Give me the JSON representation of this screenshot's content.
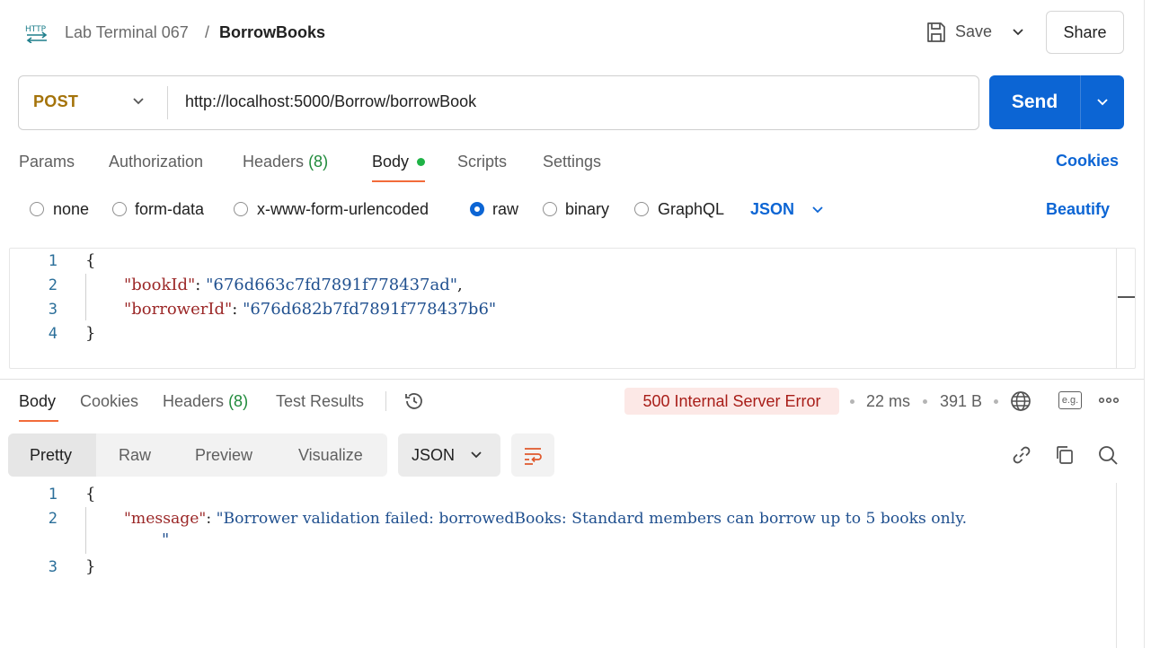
{
  "header": {
    "http_icon_label": "HTTP",
    "breadcrumb_parent": "Lab Terminal 067",
    "breadcrumb_separator": "/",
    "breadcrumb_current": "BorrowBooks",
    "save_label": "Save",
    "share_label": "Share"
  },
  "request": {
    "method": "POST",
    "url": "http://localhost:5000/Borrow/borrowBook",
    "send_label": "Send",
    "tabs": [
      {
        "label": "Params"
      },
      {
        "label": "Authorization"
      },
      {
        "label": "Headers",
        "count": "(8)"
      },
      {
        "label": "Body"
      },
      {
        "label": "Scripts"
      },
      {
        "label": "Settings"
      }
    ],
    "cookies_label": "Cookies",
    "body_types": [
      "none",
      "form-data",
      "x-www-form-urlencoded",
      "raw",
      "binary",
      "GraphQL"
    ],
    "selected_body_type": "raw",
    "language": "JSON",
    "beautify_label": "Beautify",
    "body_lines": {
      "n1": "1",
      "n2": "2",
      "n3": "3",
      "n4": "4",
      "open": "{",
      "key1": "\"bookId\"",
      "val1": "\"676d663c7fd7891f778437ad\"",
      "key2": "\"borrowerId\"",
      "val2": "\"676d682b7fd7891f778437b6\"",
      "close": "}"
    }
  },
  "response": {
    "tabs": [
      {
        "label": "Body"
      },
      {
        "label": "Cookies"
      },
      {
        "label": "Headers",
        "count": "(8)"
      },
      {
        "label": "Test Results"
      }
    ],
    "status": "500 Internal Server Error",
    "time": "22 ms",
    "size": "391 B",
    "eg_label": "e.g.",
    "view_tabs": [
      "Pretty",
      "Raw",
      "Preview",
      "Visualize"
    ],
    "format": "JSON",
    "body_lines": {
      "n1": "1",
      "n2": "2",
      "n3": "3",
      "open": "{",
      "key": "\"message\"",
      "val": "\"Borrower validation failed: borrowedBooks: Standard members can borrow up to 5 books only.",
      "val_cont": "\"",
      "close": "}"
    }
  },
  "colors": {
    "accent_blue": "#0c65d4",
    "method_post": "#a4730a",
    "active_tab_underline": "#f26b3a",
    "error_bg": "#fce8e6",
    "error_text": "#a81d18",
    "count_green": "#1f8a3a"
  },
  "icons": [
    "http-icon",
    "save-icon",
    "chevron-down-icon",
    "history-icon",
    "globe-icon",
    "more-icon",
    "wrap-icon",
    "link-icon",
    "copy-icon",
    "search-icon"
  ]
}
